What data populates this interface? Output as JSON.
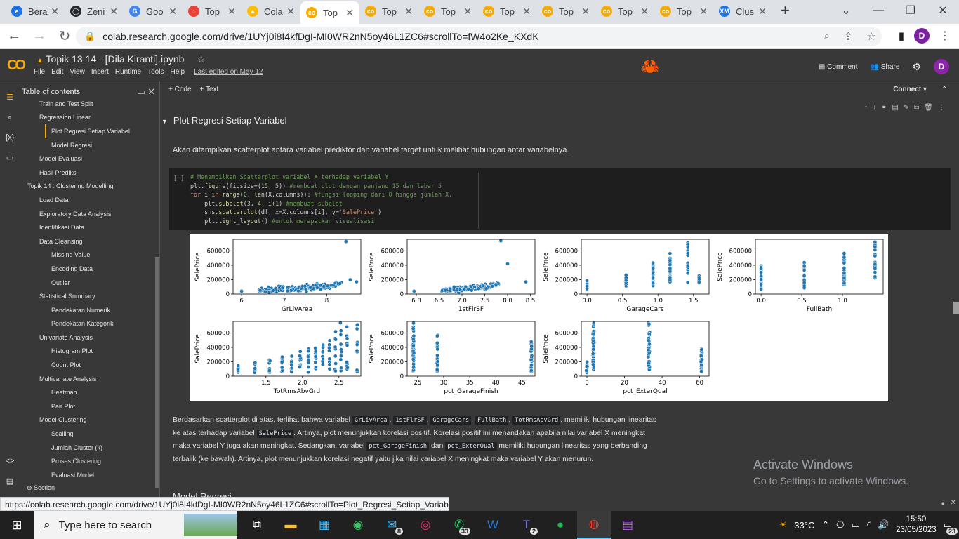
{
  "browser": {
    "tabs": [
      {
        "label": "Bera",
        "color": "#1a73e8",
        "glyph": "e"
      },
      {
        "label": "Zeni",
        "color": "#24292e",
        "glyph": "◯"
      },
      {
        "label": "Goo",
        "color": "#4285f4",
        "glyph": "G"
      },
      {
        "label": "Top",
        "color": "#ea4335",
        "glyph": "◌"
      },
      {
        "label": "Cola",
        "color": "#fbbc04",
        "glyph": "▲"
      },
      {
        "label": "Top",
        "color": "#f9ab00",
        "glyph": "co",
        "active": true
      },
      {
        "label": "Top",
        "color": "#f9ab00",
        "glyph": "co"
      },
      {
        "label": "Top",
        "color": "#f9ab00",
        "glyph": "co"
      },
      {
        "label": "Top",
        "color": "#f9ab00",
        "glyph": "co"
      },
      {
        "label": "Top",
        "color": "#f9ab00",
        "glyph": "co"
      },
      {
        "label": "Top",
        "color": "#f9ab00",
        "glyph": "co"
      },
      {
        "label": "Top",
        "color": "#f9ab00",
        "glyph": "co"
      },
      {
        "label": "Clus",
        "color": "#1a73e8",
        "glyph": "XM"
      }
    ],
    "url": "colab.research.google.com/drive/1UYj0i8I4kfDgI-MI0WR2nN5oy46L1ZC6#scrollTo=fW4o2Ke_KXdK",
    "profile_initial": "D",
    "status_url": "https://colab.research.google.com/drive/1UYj0i8I4kfDgI-MI0WR2nN5oy46L1ZC6#scrollTo=Plot_Regresi_Setiap_Variabel"
  },
  "colab": {
    "title": "Topik 13 14 - [Dila Kiranti].ipynb",
    "menu": [
      "File",
      "Edit",
      "View",
      "Insert",
      "Runtime",
      "Tools",
      "Help"
    ],
    "last_edited": "Last edited on May 12",
    "comment_label": "Comment",
    "share_label": "Share",
    "code_btn": "+ Code",
    "text_btn": "+ Text",
    "connect_label": "Connect"
  },
  "toc": {
    "title": "Table of contents",
    "items": [
      {
        "label": "Train and Test Split",
        "level": 2
      },
      {
        "label": "Regression Linear",
        "level": 2
      },
      {
        "label": "Plot Regresi Setiap Variabel",
        "level": 3,
        "selected": true
      },
      {
        "label": "Model Regresi",
        "level": 3
      },
      {
        "label": "Model Evaluasi",
        "level": 2
      },
      {
        "label": "Hasil Prediksi",
        "level": 2
      },
      {
        "label": "Topik 14 : Clustering Modelling",
        "level": 1
      },
      {
        "label": "Load Data",
        "level": 2
      },
      {
        "label": "Exploratory Data Analysis",
        "level": 2
      },
      {
        "label": "Identifikasi Data",
        "level": 2
      },
      {
        "label": "Data Cleansing",
        "level": 2
      },
      {
        "label": "Missing Value",
        "level": 3
      },
      {
        "label": "Encoding Data",
        "level": 3
      },
      {
        "label": "Outlier",
        "level": 3
      },
      {
        "label": "Statistical Summary",
        "level": 2
      },
      {
        "label": "Pendekatan Numerik",
        "level": 3
      },
      {
        "label": "Pendekatan Kategorik",
        "level": 3
      },
      {
        "label": "Univariate Analysis",
        "level": 2
      },
      {
        "label": "Histogram Plot",
        "level": 3
      },
      {
        "label": "Count Plot",
        "level": 3
      },
      {
        "label": "Multivariate Analysis",
        "level": 2
      },
      {
        "label": "Heatmap",
        "level": 3
      },
      {
        "label": "Pair Plot",
        "level": 3
      },
      {
        "label": "Model Clustering",
        "level": 2
      },
      {
        "label": "Scalling",
        "level": 3
      },
      {
        "label": "Jumlah Cluster (k)",
        "level": 3
      },
      {
        "label": "Proses Clustering",
        "level": 3
      },
      {
        "label": "Evaluasi Model",
        "level": 3
      }
    ],
    "section_label": "Section"
  },
  "notebook": {
    "section_title": "Plot Regresi Setiap Variabel",
    "intro_text": "Akan ditampilkan scatterplot antara variabel prediktor dan variabel target untuk melihat hubungan antar variabelnya.",
    "run_indicator": "[ ]",
    "code_lines": [
      "# Menampilkan Scatterplot variabel X terhadap variabel Y",
      "plt.figure(figsize=(15, 5)) #membuat plot dengan panjang 15 dan lebar 5",
      "for i in range(0, len(X.columns)): #fungsi looping dari 0 hingga jumlah X.",
      "    plt.subplot(3, 4, i+1) #membuat subplot",
      "    sns.scatterplot(df, x=X.columns[i], y='SalePrice')",
      "    plt.tight_layout() #untuk merapatkan visualisasi"
    ],
    "paragraph": [
      {
        "t": "Berdasarkan scatterplot di atas, terlihat bahwa variabel "
      },
      {
        "c": "GrLivArea"
      },
      {
        "t": ", "
      },
      {
        "c": "1stFlrSF"
      },
      {
        "t": ", "
      },
      {
        "c": "GarageCars"
      },
      {
        "t": ", "
      },
      {
        "c": "FullBath"
      },
      {
        "t": ", "
      },
      {
        "c": "TotRmsAbvGrd"
      },
      {
        "t": ", memiliki hubungan linearitas ke atas terhadap variabel "
      },
      {
        "c": "SalePrice"
      },
      {
        "t": ". Artinya, plot menunjukkan korelasi positif. Korelasi positif ini menandakan apabila nilai variabel X meningkat maka variabel Y juga akan meningkat. Sedangkan, variabel "
      },
      {
        "c": "pct_GarageFinish"
      },
      {
        "t": " dan "
      },
      {
        "c": "pct_ExterQual"
      },
      {
        "t": " memiliki hubungan linearitas yang berbanding terbalik (ke bawah). Artinya, plot menunjukkan korelasi negatif yaitu jika nilai variabel X meningkat maka variabel Y akan menurun."
      }
    ],
    "next_heading": "Model Regresi"
  },
  "chart_data": [
    {
      "type": "scatter",
      "xlabel": "GrLivArea",
      "ylabel": "SalePrice",
      "xticks": [
        6,
        7,
        8
      ],
      "xlim": [
        5.8,
        8.8
      ],
      "yticks": [
        0,
        200000,
        400000,
        600000
      ],
      "ylim": [
        0,
        760000
      ]
    },
    {
      "type": "scatter",
      "xlabel": "1stFlrSF",
      "ylabel": "SalePrice",
      "xticks": [
        6.0,
        6.5,
        7.0,
        7.5,
        8.0,
        8.5
      ],
      "xlim": [
        5.8,
        8.6
      ],
      "yticks": [
        0,
        200000,
        400000,
        600000
      ],
      "ylim": [
        0,
        760000
      ]
    },
    {
      "type": "scatter",
      "xlabel": "GarageCars",
      "ylabel": "SalePrice",
      "xticks": [
        0.0,
        0.5,
        1.0,
        1.5
      ],
      "xlim": [
        -0.08,
        1.72
      ],
      "yticks": [
        0,
        200000,
        400000,
        600000
      ],
      "ylim": [
        0,
        760000
      ]
    },
    {
      "type": "scatter",
      "xlabel": "FullBath",
      "ylabel": "SalePrice",
      "xticks": [
        0.0,
        0.5,
        1.0
      ],
      "xlim": [
        -0.07,
        1.5
      ],
      "yticks": [
        0,
        200000,
        400000,
        600000
      ],
      "ylim": [
        0,
        760000
      ]
    },
    {
      "type": "scatter",
      "xlabel": "TotRmsAbvGrd",
      "ylabel": "SalePrice",
      "xticks": [
        1.5,
        2.0,
        2.5
      ],
      "xlim": [
        1.05,
        2.8
      ],
      "yticks": [
        0,
        200000,
        400000,
        600000
      ],
      "ylim": [
        0,
        760000
      ]
    },
    {
      "type": "scatter",
      "xlabel": "pct_GarageFinish",
      "ylabel": "SalePrice",
      "xticks": [
        25,
        30,
        35,
        40,
        45
      ],
      "xlim": [
        23,
        47.5
      ],
      "yticks": [
        0,
        200000,
        400000,
        600000
      ],
      "ylim": [
        0,
        760000
      ]
    },
    {
      "type": "scatter",
      "xlabel": "pct_ExterQual",
      "ylabel": "SalePrice",
      "xticks": [
        0,
        20,
        40,
        60
      ],
      "xlim": [
        -3,
        65
      ],
      "yticks": [
        0,
        200000,
        400000,
        600000
      ],
      "ylim": [
        0,
        760000
      ]
    }
  ],
  "watermark": {
    "line1": "Activate Windows",
    "line2": "Go to Settings to activate Windows."
  },
  "taskbar": {
    "search_placeholder": "Type here to search",
    "weather": "33°C",
    "time": "15:50",
    "date": "23/05/2023",
    "notif_count": "23",
    "mail_badge": "8",
    "whatsapp_badge": "33",
    "teams_badge": "2"
  }
}
